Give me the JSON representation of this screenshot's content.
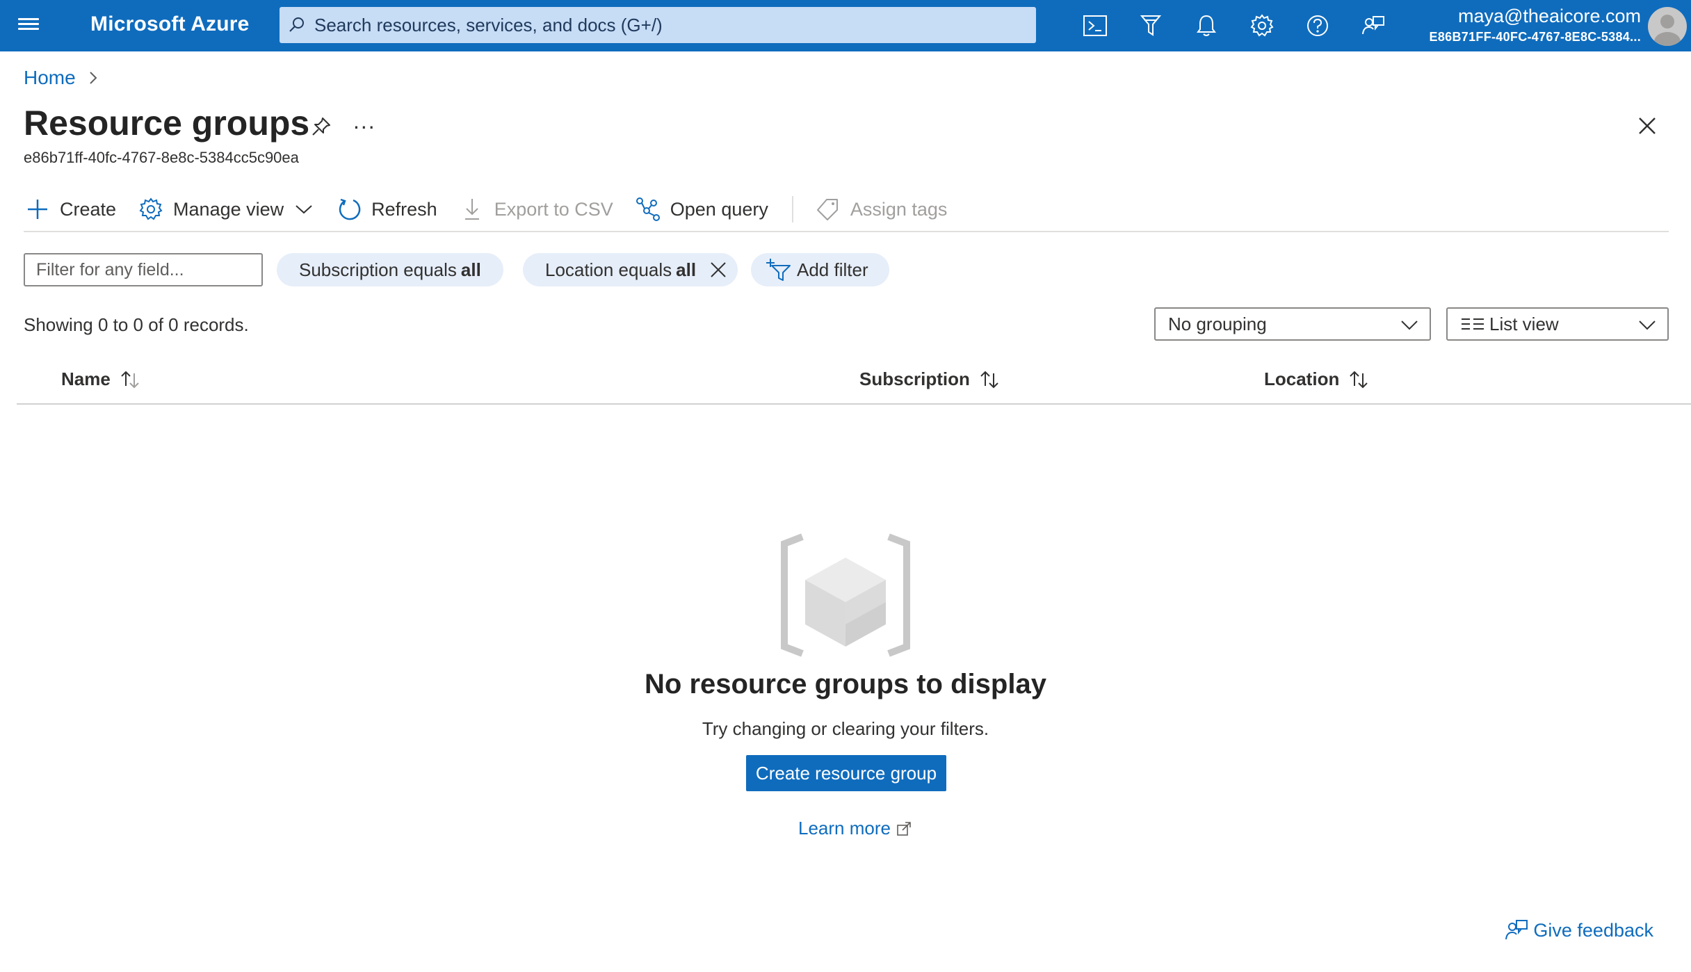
{
  "topbar": {
    "brand": "Microsoft Azure",
    "search_placeholder": "Search resources, services, and docs (G+/)",
    "icons": [
      "cloud-shell-icon",
      "directory-filter-icon",
      "notifications-icon",
      "settings-icon",
      "help-icon",
      "feedback-icon"
    ],
    "account_email": "maya@theaicore.com",
    "account_tenant": "E86B71FF-40FC-4767-8E8C-5384..."
  },
  "breadcrumb": {
    "home": "Home"
  },
  "page": {
    "title": "Resource groups",
    "subtitle": "e86b71ff-40fc-4767-8e8c-5384cc5c90ea",
    "more": "..."
  },
  "toolbar": {
    "create": "Create",
    "manage_view": "Manage view",
    "refresh": "Refresh",
    "export_csv": "Export to CSV",
    "open_query": "Open query",
    "assign_tags": "Assign tags"
  },
  "filters": {
    "input_placeholder": "Filter for any field...",
    "subscription_label": "Subscription equals",
    "subscription_value": "all",
    "location_label": "Location equals",
    "location_value": "all",
    "add_filter": "Add filter"
  },
  "records_text": "Showing 0 to 0 of 0 records.",
  "grouping": {
    "selected": "No grouping"
  },
  "view": {
    "selected": "List view"
  },
  "columns": [
    "Name",
    "Subscription",
    "Location"
  ],
  "empty": {
    "title": "No resource groups to display",
    "subtitle": "Try changing or clearing your filters.",
    "button": "Create resource group",
    "learn_more": "Learn more"
  },
  "feedback": "Give feedback",
  "colors": {
    "accent": "#0f6cbd",
    "pill_bg": "#e6eef9"
  }
}
